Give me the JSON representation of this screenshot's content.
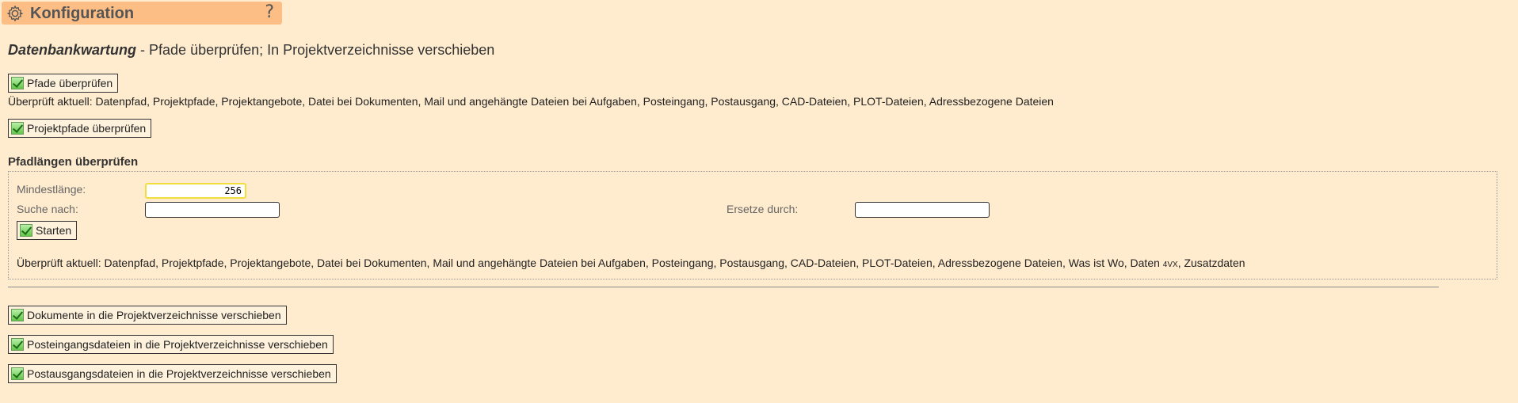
{
  "header": {
    "title": "Konfiguration",
    "help_symbol": "?",
    "icon": "gear-icon"
  },
  "page": {
    "heading_emph": "Datenbankwartung",
    "heading_rest": " - Pfade überprüfen; In Projektverzeichnisse verschieben"
  },
  "buttons": {
    "pfade": "Pfade überprüfen",
    "projektpfade": "Projektpfade überprüfen",
    "starten": "Starten",
    "dokumente": "Dokumente in die Projektverzeichnisse verschieben",
    "posteingang": "Posteingangsdateien in die Projektverzeichnisse verschieben",
    "postausgang": "Postausgangsdateien in die Projektverzeichnisse verschieben"
  },
  "info": {
    "pfade_checked": "Überprüft aktuell: Datenpfad, Projektpfade, Projektangebote, Datei bei Dokumenten, Mail und angehängte Dateien bei Aufgaben, Posteingang, Postausgang, CAD-Dateien, PLOT-Dateien, Adressbezogene Dateien",
    "laengen_checked_prefix": "Überprüft aktuell: Datenpfad, Projektpfade, Projektangebote, Datei bei Dokumenten, Mail und angehängte Dateien bei Aufgaben, Posteingang, Postausgang, CAD-Dateien, PLOT-Dateien, Adressbezogene Dateien, Was ist Wo, Daten ",
    "laengen_checked_small": "4VX",
    "laengen_checked_suffix": ", Zusatzdaten"
  },
  "pfadlaengen": {
    "title": "Pfadlängen überprüfen",
    "mindestlaenge_label": "Mindestlänge:",
    "mindestlaenge_value": "256",
    "suche_label": "Suche nach:",
    "suche_value": "",
    "ersetze_label": "Ersetze durch:",
    "ersetze_value": ""
  },
  "colors": {
    "background": "#ffebcd",
    "title_bar": "#fcbe85",
    "check_icon": "#62c54a"
  }
}
